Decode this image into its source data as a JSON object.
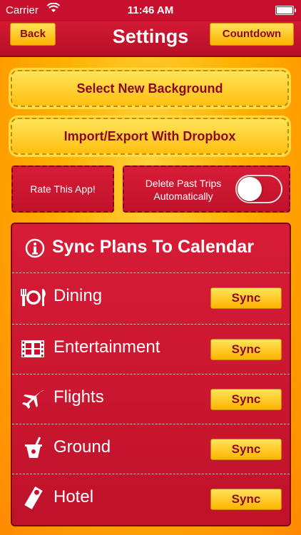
{
  "status": {
    "carrier": "Carrier",
    "time": "11:46 AM"
  },
  "nav": {
    "title": "Settings",
    "back_label": "Back",
    "countdown_label": "Countdown"
  },
  "actions": {
    "background_label": "Select New Background",
    "dropbox_label": "Import/Export With Dropbox",
    "rate_label": "Rate This App!",
    "delete_label_line1": "Delete Past Trips",
    "delete_label_line2": "Automatically",
    "delete_toggle_on": false
  },
  "sync": {
    "title": "Sync Plans To Calendar",
    "items": [
      {
        "label": "Dining",
        "button": "Sync",
        "icon": "dining-icon"
      },
      {
        "label": "Entertainment",
        "button": "Sync",
        "icon": "film-icon"
      },
      {
        "label": "Flights",
        "button": "Sync",
        "icon": "airplane-icon"
      },
      {
        "label": "Ground",
        "button": "Sync",
        "icon": "ground-icon"
      },
      {
        "label": "Hotel",
        "button": "Sync",
        "icon": "hotel-tag-icon"
      }
    ]
  },
  "colors": {
    "primary_red": "#c8102e",
    "accent_yellow": "#ffc21a",
    "text_dark_red": "#8a0a1a"
  }
}
